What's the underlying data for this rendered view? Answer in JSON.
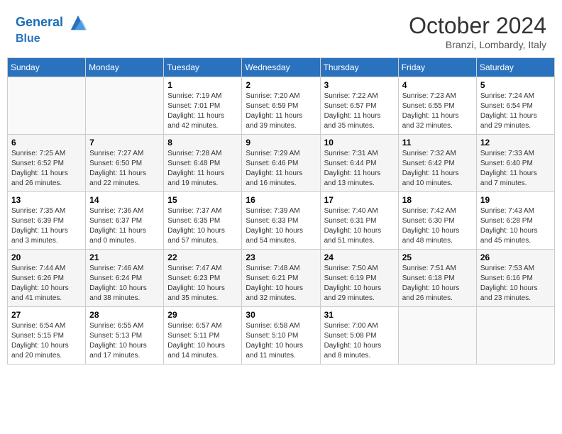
{
  "header": {
    "logo_line1": "General",
    "logo_line2": "Blue",
    "month_title": "October 2024",
    "location": "Branzi, Lombardy, Italy"
  },
  "weekdays": [
    "Sunday",
    "Monday",
    "Tuesday",
    "Wednesday",
    "Thursday",
    "Friday",
    "Saturday"
  ],
  "weeks": [
    [
      {
        "day": "",
        "sunrise": "",
        "sunset": "",
        "daylight": ""
      },
      {
        "day": "",
        "sunrise": "",
        "sunset": "",
        "daylight": ""
      },
      {
        "day": "1",
        "sunrise": "Sunrise: 7:19 AM",
        "sunset": "Sunset: 7:01 PM",
        "daylight": "Daylight: 11 hours and 42 minutes."
      },
      {
        "day": "2",
        "sunrise": "Sunrise: 7:20 AM",
        "sunset": "Sunset: 6:59 PM",
        "daylight": "Daylight: 11 hours and 39 minutes."
      },
      {
        "day": "3",
        "sunrise": "Sunrise: 7:22 AM",
        "sunset": "Sunset: 6:57 PM",
        "daylight": "Daylight: 11 hours and 35 minutes."
      },
      {
        "day": "4",
        "sunrise": "Sunrise: 7:23 AM",
        "sunset": "Sunset: 6:55 PM",
        "daylight": "Daylight: 11 hours and 32 minutes."
      },
      {
        "day": "5",
        "sunrise": "Sunrise: 7:24 AM",
        "sunset": "Sunset: 6:54 PM",
        "daylight": "Daylight: 11 hours and 29 minutes."
      }
    ],
    [
      {
        "day": "6",
        "sunrise": "Sunrise: 7:25 AM",
        "sunset": "Sunset: 6:52 PM",
        "daylight": "Daylight: 11 hours and 26 minutes."
      },
      {
        "day": "7",
        "sunrise": "Sunrise: 7:27 AM",
        "sunset": "Sunset: 6:50 PM",
        "daylight": "Daylight: 11 hours and 22 minutes."
      },
      {
        "day": "8",
        "sunrise": "Sunrise: 7:28 AM",
        "sunset": "Sunset: 6:48 PM",
        "daylight": "Daylight: 11 hours and 19 minutes."
      },
      {
        "day": "9",
        "sunrise": "Sunrise: 7:29 AM",
        "sunset": "Sunset: 6:46 PM",
        "daylight": "Daylight: 11 hours and 16 minutes."
      },
      {
        "day": "10",
        "sunrise": "Sunrise: 7:31 AM",
        "sunset": "Sunset: 6:44 PM",
        "daylight": "Daylight: 11 hours and 13 minutes."
      },
      {
        "day": "11",
        "sunrise": "Sunrise: 7:32 AM",
        "sunset": "Sunset: 6:42 PM",
        "daylight": "Daylight: 11 hours and 10 minutes."
      },
      {
        "day": "12",
        "sunrise": "Sunrise: 7:33 AM",
        "sunset": "Sunset: 6:40 PM",
        "daylight": "Daylight: 11 hours and 7 minutes."
      }
    ],
    [
      {
        "day": "13",
        "sunrise": "Sunrise: 7:35 AM",
        "sunset": "Sunset: 6:39 PM",
        "daylight": "Daylight: 11 hours and 3 minutes."
      },
      {
        "day": "14",
        "sunrise": "Sunrise: 7:36 AM",
        "sunset": "Sunset: 6:37 PM",
        "daylight": "Daylight: 11 hours and 0 minutes."
      },
      {
        "day": "15",
        "sunrise": "Sunrise: 7:37 AM",
        "sunset": "Sunset: 6:35 PM",
        "daylight": "Daylight: 10 hours and 57 minutes."
      },
      {
        "day": "16",
        "sunrise": "Sunrise: 7:39 AM",
        "sunset": "Sunset: 6:33 PM",
        "daylight": "Daylight: 10 hours and 54 minutes."
      },
      {
        "day": "17",
        "sunrise": "Sunrise: 7:40 AM",
        "sunset": "Sunset: 6:31 PM",
        "daylight": "Daylight: 10 hours and 51 minutes."
      },
      {
        "day": "18",
        "sunrise": "Sunrise: 7:42 AM",
        "sunset": "Sunset: 6:30 PM",
        "daylight": "Daylight: 10 hours and 48 minutes."
      },
      {
        "day": "19",
        "sunrise": "Sunrise: 7:43 AM",
        "sunset": "Sunset: 6:28 PM",
        "daylight": "Daylight: 10 hours and 45 minutes."
      }
    ],
    [
      {
        "day": "20",
        "sunrise": "Sunrise: 7:44 AM",
        "sunset": "Sunset: 6:26 PM",
        "daylight": "Daylight: 10 hours and 41 minutes."
      },
      {
        "day": "21",
        "sunrise": "Sunrise: 7:46 AM",
        "sunset": "Sunset: 6:24 PM",
        "daylight": "Daylight: 10 hours and 38 minutes."
      },
      {
        "day": "22",
        "sunrise": "Sunrise: 7:47 AM",
        "sunset": "Sunset: 6:23 PM",
        "daylight": "Daylight: 10 hours and 35 minutes."
      },
      {
        "day": "23",
        "sunrise": "Sunrise: 7:48 AM",
        "sunset": "Sunset: 6:21 PM",
        "daylight": "Daylight: 10 hours and 32 minutes."
      },
      {
        "day": "24",
        "sunrise": "Sunrise: 7:50 AM",
        "sunset": "Sunset: 6:19 PM",
        "daylight": "Daylight: 10 hours and 29 minutes."
      },
      {
        "day": "25",
        "sunrise": "Sunrise: 7:51 AM",
        "sunset": "Sunset: 6:18 PM",
        "daylight": "Daylight: 10 hours and 26 minutes."
      },
      {
        "day": "26",
        "sunrise": "Sunrise: 7:53 AM",
        "sunset": "Sunset: 6:16 PM",
        "daylight": "Daylight: 10 hours and 23 minutes."
      }
    ],
    [
      {
        "day": "27",
        "sunrise": "Sunrise: 6:54 AM",
        "sunset": "Sunset: 5:15 PM",
        "daylight": "Daylight: 10 hours and 20 minutes."
      },
      {
        "day": "28",
        "sunrise": "Sunrise: 6:55 AM",
        "sunset": "Sunset: 5:13 PM",
        "daylight": "Daylight: 10 hours and 17 minutes."
      },
      {
        "day": "29",
        "sunrise": "Sunrise: 6:57 AM",
        "sunset": "Sunset: 5:11 PM",
        "daylight": "Daylight: 10 hours and 14 minutes."
      },
      {
        "day": "30",
        "sunrise": "Sunrise: 6:58 AM",
        "sunset": "Sunset: 5:10 PM",
        "daylight": "Daylight: 10 hours and 11 minutes."
      },
      {
        "day": "31",
        "sunrise": "Sunrise: 7:00 AM",
        "sunset": "Sunset: 5:08 PM",
        "daylight": "Daylight: 10 hours and 8 minutes."
      },
      {
        "day": "",
        "sunrise": "",
        "sunset": "",
        "daylight": ""
      },
      {
        "day": "",
        "sunrise": "",
        "sunset": "",
        "daylight": ""
      }
    ]
  ]
}
